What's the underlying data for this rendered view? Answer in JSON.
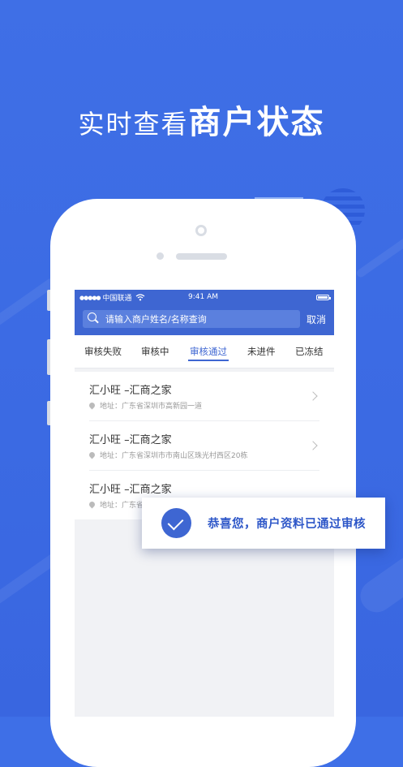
{
  "headline": {
    "light": "实时查看",
    "bold": "商户状态"
  },
  "status_bar": {
    "carrier": "中国联通",
    "signal": "●●●●●",
    "time": "9:41 AM"
  },
  "search": {
    "placeholder": "请输入商户姓名/名称查询",
    "cancel": "取消"
  },
  "tabs": [
    {
      "label": "审核失败"
    },
    {
      "label": "审核中"
    },
    {
      "label": "审核通过",
      "active": true
    },
    {
      "label": "未进件"
    },
    {
      "label": "已冻结"
    }
  ],
  "merchants": [
    {
      "name": "汇小旺 –汇商之家",
      "address": "地址：广东省深圳市高新园一道"
    },
    {
      "name": "汇小旺 –汇商之家",
      "address": "地址：广东省深圳市市南山区珠光村西区20栋"
    },
    {
      "name": "汇小旺 –汇商之家",
      "address": "地址：广东省"
    }
  ],
  "toast": {
    "message": "恭喜您，商户资料已通过审核"
  },
  "colors": {
    "background": "#3E6FE7",
    "accent": "#3E66D2"
  },
  "icons": [
    "search-icon",
    "wifi-icon",
    "battery-icon",
    "location-pin-icon",
    "chevron-right-icon",
    "check-icon"
  ]
}
